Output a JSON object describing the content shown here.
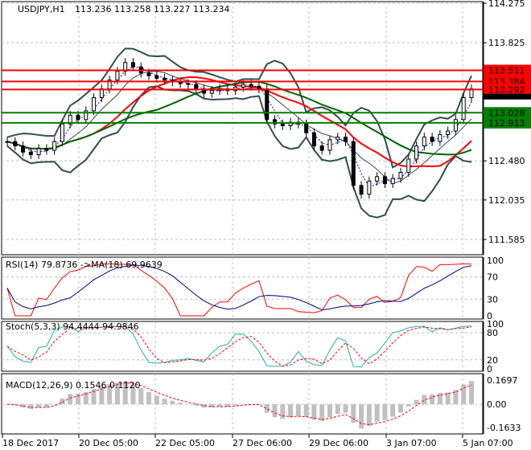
{
  "chart_data": {
    "type": "candlestick",
    "title": "USDJPY,H1",
    "ohlc_label": "113.236 113.258 113.227 113.234",
    "ylim": [
      111.585,
      114.275
    ],
    "y_ticks": [
      "114.275",
      "113.825",
      "112.480",
      "112.035",
      "111.585"
    ],
    "current_price": "113.234",
    "levels": [
      {
        "value": 113.511,
        "label": "113.511",
        "color": "#ff0000"
      },
      {
        "value": 113.384,
        "label": "113.384",
        "color": "#ff0000"
      },
      {
        "value": 113.292,
        "label": "113.292",
        "color": "#ff0000"
      },
      {
        "value": 113.028,
        "label": "113.028",
        "color": "#008000"
      },
      {
        "value": 112.913,
        "label": "112.913",
        "color": "#008000"
      }
    ],
    "x_labels": [
      "18 Dec 2017",
      "20 Dec 05:00",
      "22 Dec 05:00",
      "27 Dec 06:00",
      "29 Dec 06:00",
      "3 Jan 07:00",
      "5 Jan 07:00"
    ],
    "closes": [
      112.7,
      112.65,
      112.58,
      112.55,
      112.62,
      112.6,
      112.7,
      112.9,
      113.0,
      112.95,
      113.05,
      113.2,
      113.3,
      113.4,
      113.5,
      113.6,
      113.55,
      113.48,
      113.45,
      113.42,
      113.4,
      113.38,
      113.36,
      113.35,
      113.3,
      113.25,
      113.28,
      113.3,
      113.28,
      113.32,
      113.35,
      113.33,
      113.3,
      112.95,
      112.9,
      112.88,
      112.92,
      112.9,
      112.8,
      112.65,
      112.6,
      112.72,
      112.75,
      112.7,
      112.2,
      112.1,
      112.25,
      112.3,
      112.22,
      112.28,
      112.35,
      112.5,
      112.65,
      112.75,
      112.7,
      112.78,
      112.82,
      112.95,
      113.2,
      113.3
    ],
    "rsi": {
      "label": "RSI(14) 79.8736  ->MA(18) 69.9639",
      "ticks": [
        "100",
        "70",
        "30",
        "0"
      ]
    },
    "stoch": {
      "label": "Stoch(5,3,3) 94.4444 94.9846",
      "ticks": [
        "100",
        "80",
        "20",
        "0"
      ]
    },
    "macd": {
      "label": "MACD(12,26,9) 0.1546 0.1120",
      "ticks": [
        "0.1697",
        "0.00",
        "-0.1633"
      ],
      "range": [
        -0.1633,
        0.1697
      ]
    },
    "colors": {
      "candle": "#000000",
      "bands": "#2f4f4f",
      "ma_red": "#ff0000",
      "ma_green": "#006400",
      "rsi": "#ff0000",
      "rsi_ma": "#000080",
      "stoch_main": "#20b2aa",
      "stoch_signal": "#ff0000",
      "macd_hist": "#c0c0c0",
      "macd_signal": "#ff0000"
    }
  }
}
